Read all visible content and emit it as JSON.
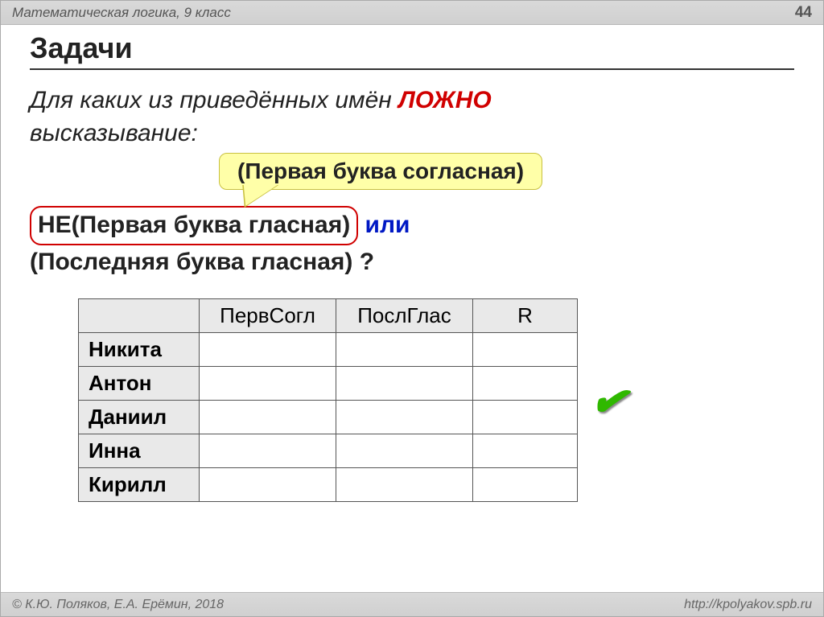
{
  "header": {
    "subject": "Математическая логика, 9 класс",
    "page": "44"
  },
  "title": "Задачи",
  "intro": {
    "line1_a": "Для каких из приведённых имён ",
    "false_word": "ЛОЖНО",
    "line2": "высказывание:"
  },
  "callout": "(Первая буква согласная)",
  "expr": {
    "part1": "НЕ(Первая буква гласная)",
    "or": " или",
    "part2": "(Последняя буква гласная) ?"
  },
  "table": {
    "cols": [
      "ПервСогл",
      "ПослГлас",
      "R"
    ],
    "rows": [
      "Никита",
      "Антон",
      "Даниил",
      "Инна",
      "Кирилл"
    ]
  },
  "check": "✔",
  "footer": {
    "left": "© К.Ю. Поляков, Е.А. Ерёмин, 2018",
    "right": "http://kpolyakov.spb.ru"
  }
}
